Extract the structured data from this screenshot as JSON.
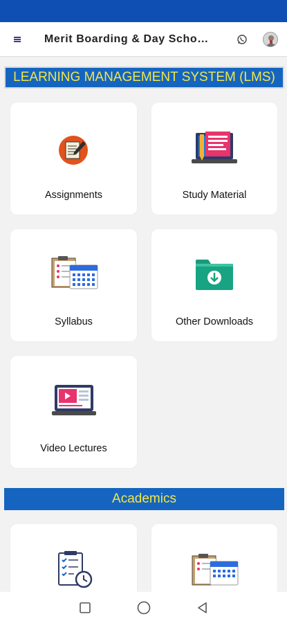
{
  "app_bar": {
    "title": "Merit Boarding & Day Scho…",
    "menu_icon": "menu-icon",
    "whatsapp_icon": "whatsapp-icon",
    "avatar_icon": "avatar-icon"
  },
  "lms": {
    "heading": "LEARNING MANAGEMENT SYSTEM (LMS)",
    "items": [
      {
        "label": "Assignments",
        "icon": "assignment-icon"
      },
      {
        "label": "Study Material",
        "icon": "study-material-icon"
      },
      {
        "label": "Syllabus",
        "icon": "syllabus-icon"
      },
      {
        "label": "Other Downloads",
        "icon": "download-folder-icon"
      },
      {
        "label": "Video Lectures",
        "icon": "video-lecture-icon"
      }
    ]
  },
  "academics": {
    "heading": "Academics",
    "items": [
      {
        "icon": "checklist-clock-icon"
      },
      {
        "icon": "calendar-clipboard-icon"
      }
    ]
  },
  "nav": {
    "recents_icon": "recents-square-icon",
    "home_icon": "home-circle-icon",
    "back_icon": "back-triangle-icon"
  },
  "colors": {
    "status_bar": "#0f4fb4",
    "banner_bg": "#1565c0",
    "banner_text": "#f2e64a",
    "page_bg": "#f2f2f2"
  }
}
